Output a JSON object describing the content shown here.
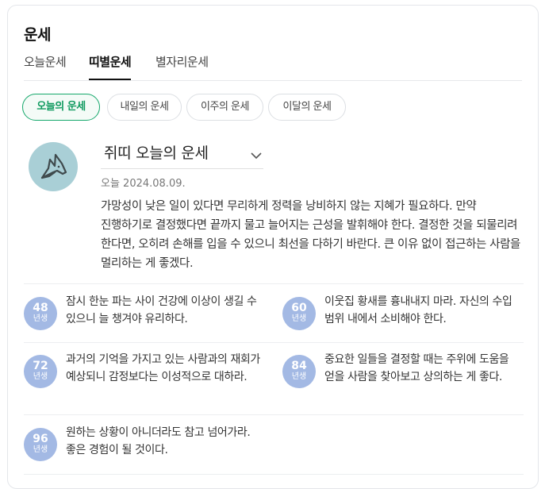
{
  "title": "운세",
  "tabs": [
    "오늘운세",
    "띠별운세",
    "별자리운세"
  ],
  "chips": [
    "오늘의 운세",
    "내일의 운세",
    "이주의 운세",
    "이달의 운세"
  ],
  "zodiac": {
    "name": "쥐띠 오늘의 운세",
    "icon": "rat-icon",
    "date": "오늘 2024.08.09.",
    "text": "가망성이 낮은 일이 있다면 무리하게 정력을 낭비하지 않는 지혜가 필요하다. 만약 진행하기로 결정했다면 끝까지 물고 늘어지는 근성을 발휘해야 한다. 결정한 것을 되물리려 한다면, 오히려 손해를 입을 수 있으니 최선을 다하기 바란다. 큰 이유 없이 접근하는 사람을 멀리하는 게 좋겠다."
  },
  "years": [
    {
      "year": "48",
      "unit": "년생",
      "text": "잠시 한눈 파는 사이 건강에 이상이 생길 수 있으니 늘 챙겨야 유리하다."
    },
    {
      "year": "60",
      "unit": "년생",
      "text": "이웃집 황새를 흉내내지 마라. 자신의 수입 범위 내에서 소비해야 한다."
    },
    {
      "year": "72",
      "unit": "년생",
      "text": "과거의 기억을 가지고 있는 사람과의 재회가 예상되니 감정보다는 이성적으로 대하라."
    },
    {
      "year": "84",
      "unit": "년생",
      "text": "중요한 일들을 결정할 때는 주위에 도움을 얻을 사람을 찾아보고 상의하는 게 좋다."
    },
    {
      "year": "96",
      "unit": "년생",
      "text": "원하는 상황이 아니더라도 참고 넘어가라. 좋은 경험이 될 것이다."
    }
  ],
  "colors": {
    "accent": "#16a86c",
    "year_circle": "#a3b9e4",
    "avatar_bg": "#a9cfd6"
  }
}
